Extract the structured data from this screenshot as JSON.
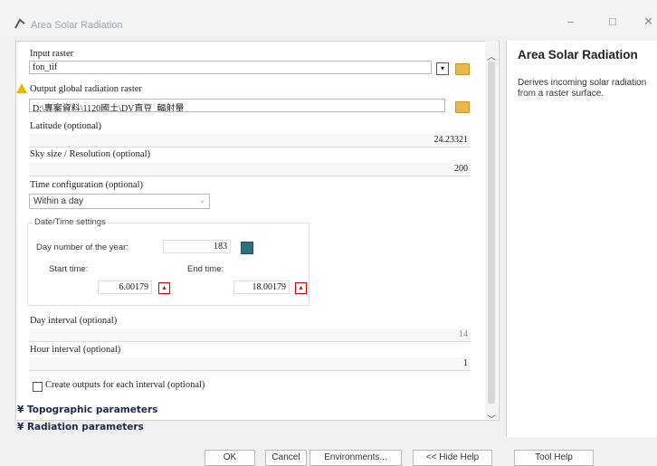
{
  "window": {
    "title": "Area Solar Radiation",
    "minimize": "–",
    "maximize": "□",
    "close": "✕"
  },
  "form": {
    "input_raster": {
      "label": "Input raster",
      "value": "fon_tif"
    },
    "output_raster": {
      "label": "Output global radiation raster",
      "value": "D:\\專案資料\\1120國土\\DV直豆_輻射量"
    },
    "latitude": {
      "label": "Latitude (optional)",
      "value": "24.23321"
    },
    "sky_size": {
      "label": "Sky size / Resolution (optional)",
      "value": "200"
    },
    "time_config": {
      "label": "Time configuration (optional)",
      "value": "Within a day"
    },
    "datetime": {
      "legend": "Date/Time settings",
      "day_label": "Day number of the year:",
      "day_value": "183",
      "start_label": "Start time:",
      "start_value": "6.00179",
      "end_label": "End time:",
      "end_value": "18.00179"
    },
    "day_interval": {
      "label": "Day interval (optional)",
      "value": "14"
    },
    "hour_interval": {
      "label": "Hour interval (optional)",
      "value": "1"
    },
    "create_outputs": {
      "label": "Create outputs for each interval (optional)"
    },
    "sections": [
      "Topographic parameters",
      "Radiation parameters"
    ]
  },
  "help": {
    "title": "Area Solar Radiation",
    "description": "Derives incoming solar radiation from a raster surface."
  },
  "buttons": {
    "ok": "OK",
    "cancel": "Cancel",
    "environments": "Environments...",
    "hide_help": "<< Hide Help",
    "tool_help": "Tool Help"
  },
  "colors": {
    "accent": "#1b2a4a",
    "warning": "#e6b800",
    "folder": "#e8b84a"
  }
}
